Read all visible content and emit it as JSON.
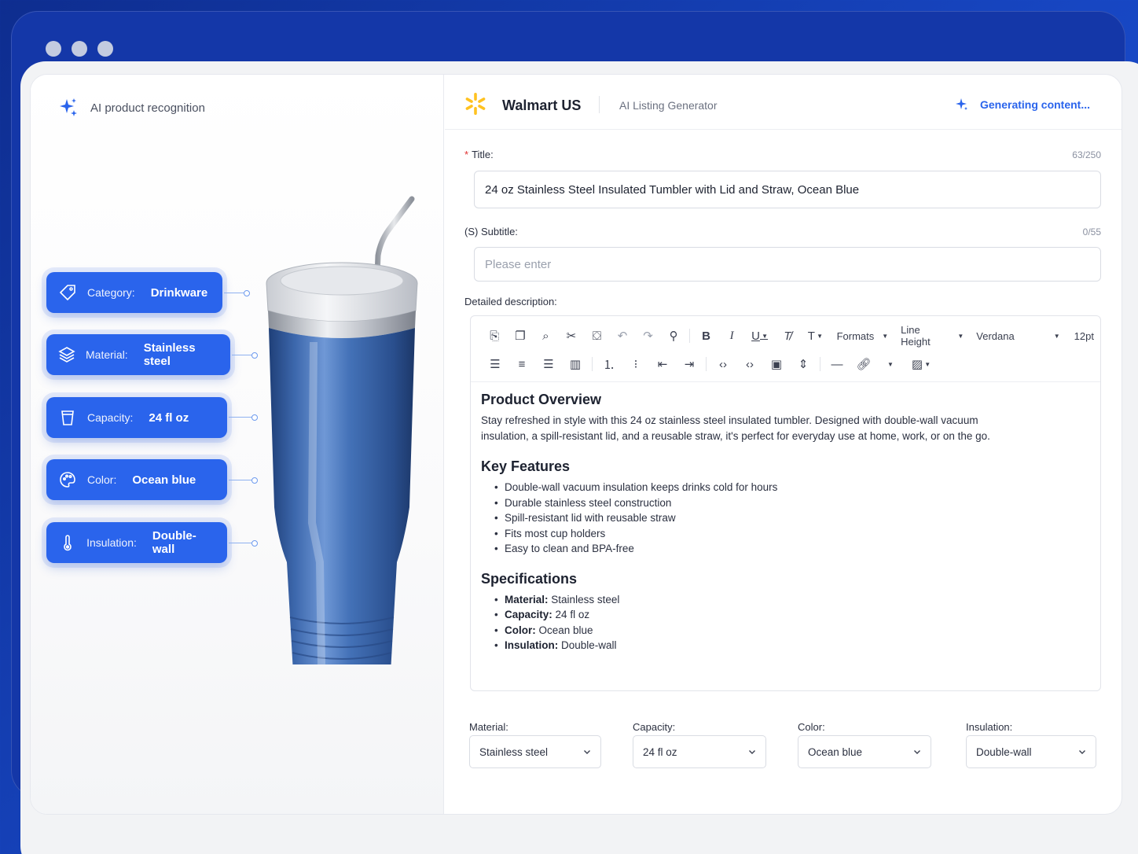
{
  "left_panel": {
    "header": "AI product recognition",
    "attributes": [
      {
        "label": "Category:",
        "value": "Drinkware",
        "icon": "tag-icon"
      },
      {
        "label": "Material:",
        "value": "Stainless steel",
        "icon": "layers-icon"
      },
      {
        "label": "Capacity:",
        "value": "24 fl oz",
        "icon": "cup-icon"
      },
      {
        "label": "Color:",
        "value": "Ocean blue",
        "icon": "palette-icon"
      },
      {
        "label": "Insulation:",
        "value": "Double-wall",
        "icon": "thermometer-icon"
      }
    ]
  },
  "header": {
    "store": "Walmart US",
    "tool": "AI Listing Generator",
    "status": "Generating content..."
  },
  "form": {
    "title": {
      "label": "Title:",
      "counter": "63/250",
      "value": "24 oz Stainless Steel Insulated Tumbler with Lid and Straw, Ocean Blue"
    },
    "subtitle": {
      "label": "(S) Subtitle:",
      "counter": "0/55",
      "placeholder": "Please enter"
    },
    "description_label": "Detailed description:"
  },
  "toolbar": {
    "formats": "Formats",
    "line_height": "Line Height",
    "font": "Verdana",
    "size": "12pt"
  },
  "description": {
    "overview_heading": "Product Overview",
    "overview_text": "Stay refreshed in style with this 24 oz stainless steel insulated tumbler. Designed with double-wall vacuum insulation, a spill-resistant lid, and a reusable straw, it's perfect for everyday use at home, work, or on the go.",
    "features_heading": "Key Features",
    "features": [
      "Double-wall vacuum insulation keeps drinks cold for hours",
      "Durable stainless steel construction",
      "Spill-resistant lid with reusable straw",
      "Fits most cup holders",
      "Easy to clean and BPA-free"
    ],
    "specs_heading": "Specifications",
    "specs": [
      {
        "key": "Material:",
        "value": "Stainless steel"
      },
      {
        "key": "Capacity:",
        "value": "24 fl oz"
      },
      {
        "key": "Color:",
        "value": "Ocean blue"
      },
      {
        "key": "Insulation:",
        "value": "Double-wall"
      }
    ]
  },
  "attribute_selects": [
    {
      "label": "Material:",
      "value": "Stainless steel"
    },
    {
      "label": "Capacity:",
      "value": "24 fl oz"
    },
    {
      "label": "Color:",
      "value": "Ocean blue"
    },
    {
      "label": "Insulation:",
      "value": "Double-wall"
    }
  ],
  "colors": {
    "accent": "#2a64ec",
    "walmart_spark": "#ffc220",
    "tumbler": "#3f6cb0"
  }
}
